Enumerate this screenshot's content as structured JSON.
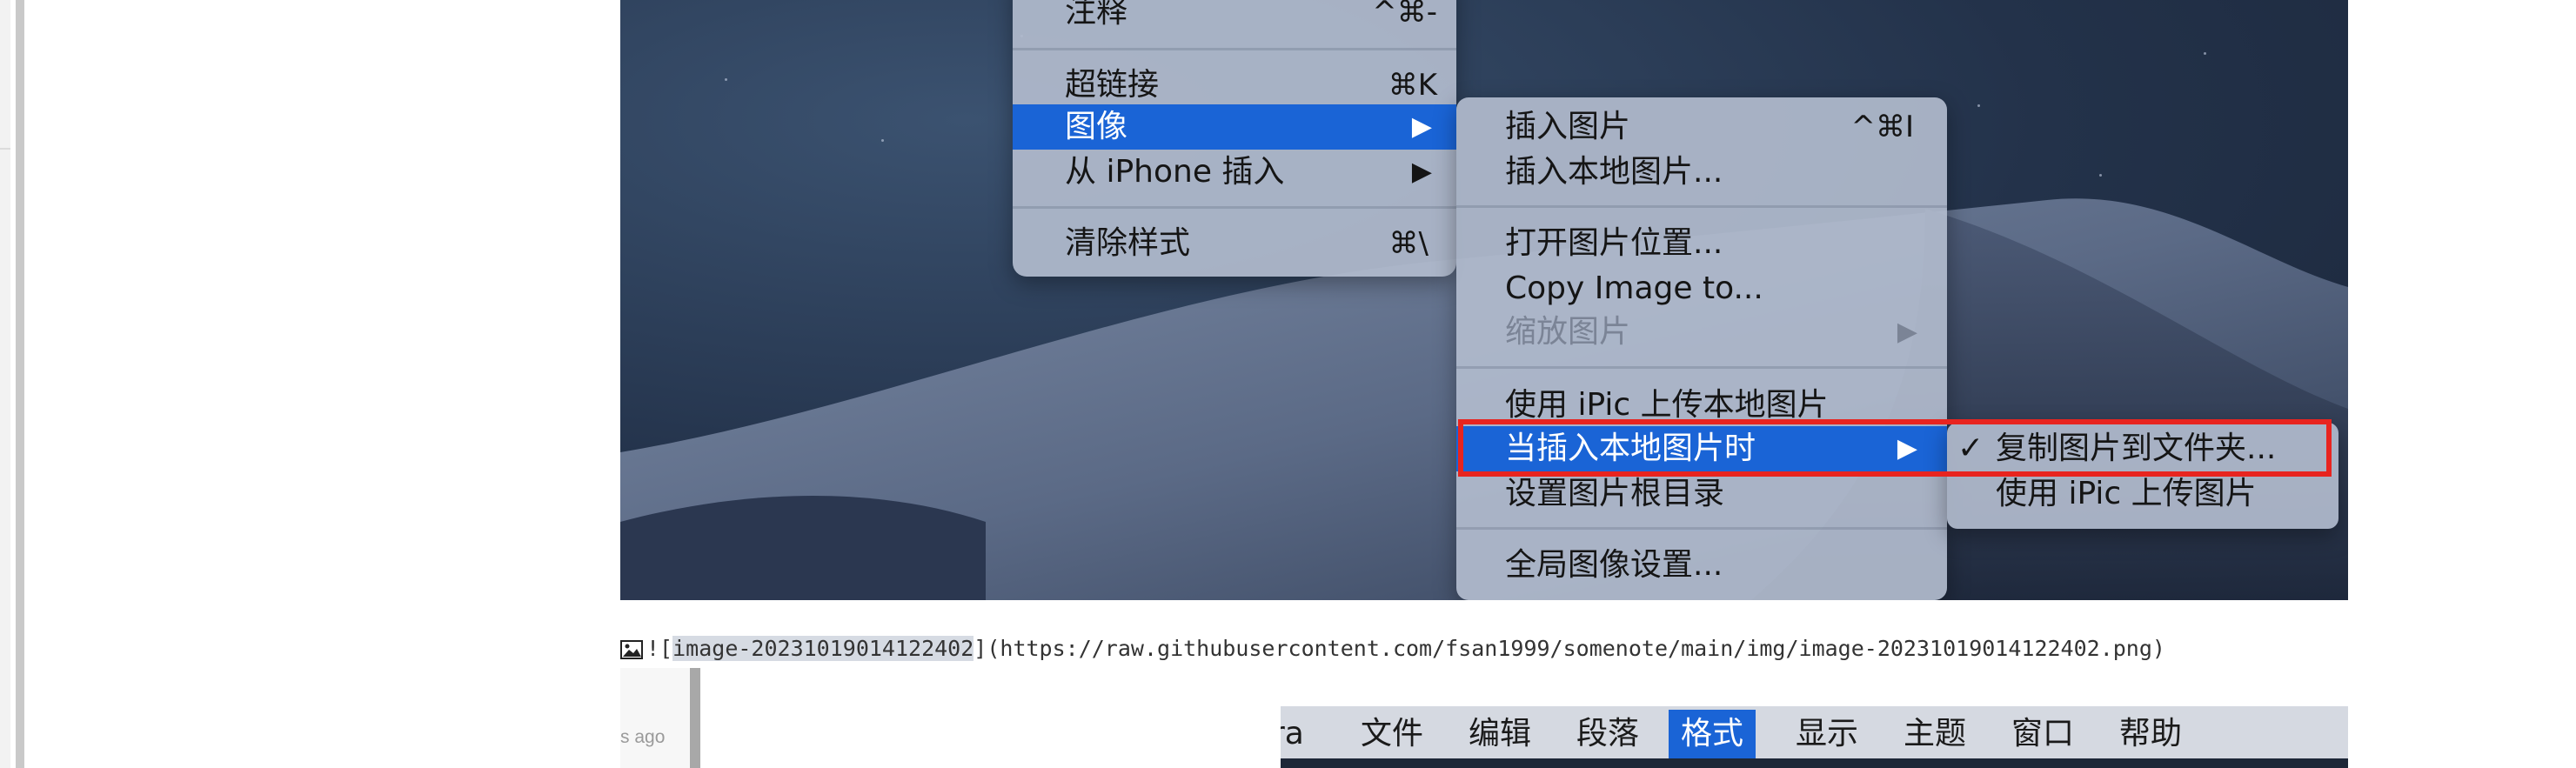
{
  "menu_main": {
    "items": [
      {
        "label": "注释",
        "shortcut": "^⌘-"
      },
      {
        "label": "超链接",
        "shortcut": "⌘K"
      },
      {
        "label": "图像",
        "arrow": "▶"
      },
      {
        "label": "从 iPhone 插入",
        "arrow": "▶"
      },
      {
        "label": "清除样式",
        "shortcut": "⌘\\"
      }
    ]
  },
  "menu_image": {
    "items": [
      {
        "label": "插入图片",
        "shortcut": "^⌘I"
      },
      {
        "label": "插入本地图片..."
      },
      {
        "label": "打开图片位置..."
      },
      {
        "label": "Copy Image to..."
      },
      {
        "label": "缩放图片",
        "arrow": "▶"
      },
      {
        "label": "使用 iPic 上传本地图片"
      },
      {
        "label": "当插入本地图片时",
        "arrow": "▶"
      },
      {
        "label": "设置图片根目录"
      },
      {
        "label": "全局图像设置..."
      }
    ]
  },
  "menu_insert_local": {
    "items": [
      {
        "label": "复制图片到文件夹...",
        "check": "✓"
      },
      {
        "label": "使用 iPic 上传图片"
      }
    ]
  },
  "markdown": {
    "prefix": "![",
    "alt": "image-20231019014122402",
    "suffix": "](https://raw.githubusercontent.com/fsan1999/somenote/main/img/image-20231019014122402.png)"
  },
  "lower_preview": {
    "time_label": "s ago",
    "menubar": [
      {
        "label": "ra"
      },
      {
        "label": "文件"
      },
      {
        "label": "编辑"
      },
      {
        "label": "段落"
      },
      {
        "label": "格式"
      },
      {
        "label": "显示"
      },
      {
        "label": "主题"
      },
      {
        "label": "窗口"
      },
      {
        "label": "帮助"
      }
    ]
  },
  "colors": {
    "highlight": "#1a64d6",
    "annotation_box": "#e8241f",
    "selection": "#d6dbe3"
  }
}
